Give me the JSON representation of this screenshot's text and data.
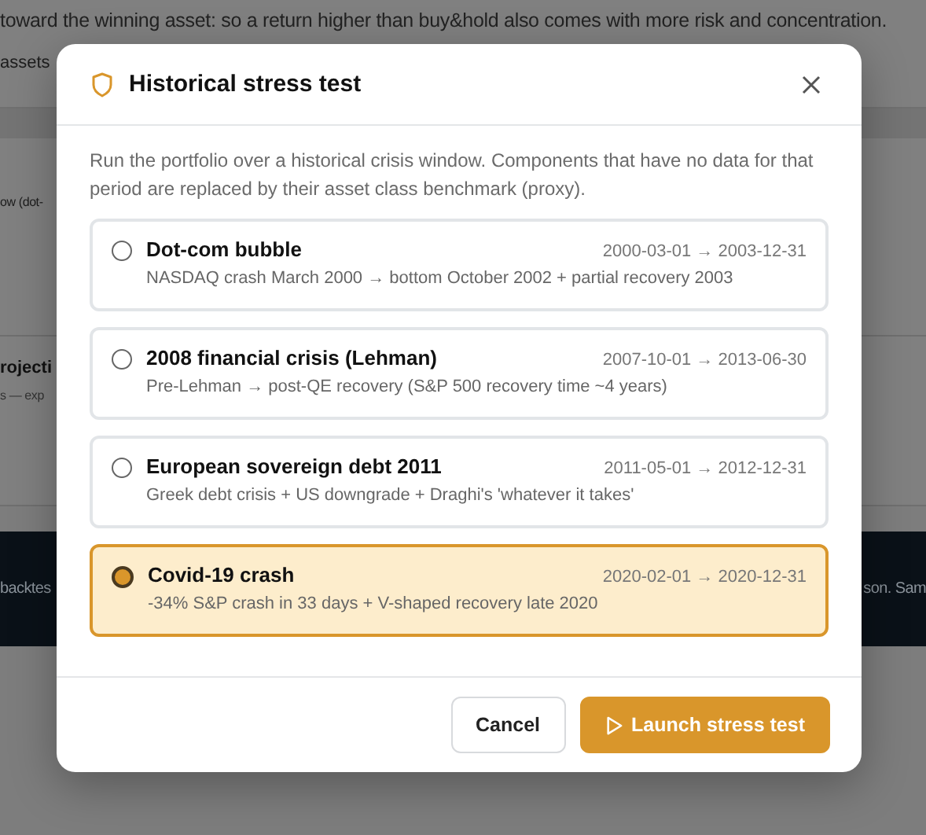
{
  "background": {
    "intro_text": "toward the winning asset: so a return higher than buy&hold also comes with more risk and concentration.",
    "assets_text": "assets",
    "dotcom_text": "ow (dot-",
    "projection_title": "rojecti",
    "projection_text": "s — exp",
    "banner_left": "backtes",
    "banner_right": "son. Sam"
  },
  "dialog": {
    "title": "Historical stress test",
    "description": "Run the portfolio over a historical crisis window. Components that have no data for that period are replaced by their asset class benchmark (proxy).",
    "options": [
      {
        "title": "Dot-com bubble",
        "dates": "2000-03-01 → 2003-12-31",
        "description": "NASDAQ crash March 2000 → bottom October 2002 + partial recovery 2003",
        "selected": false
      },
      {
        "title": "2008 financial crisis (Lehman)",
        "dates": "2007-10-01 → 2013-06-30",
        "description": "Pre-Lehman → post-QE recovery (S&P 500 recovery time ~4 years)",
        "selected": false
      },
      {
        "title": "European sovereign debt 2011",
        "dates": "2011-05-01 → 2012-12-31",
        "description": "Greek debt crisis + US downgrade + Draghi's 'whatever it takes'",
        "selected": false
      },
      {
        "title": "Covid-19 crash",
        "dates": "2020-02-01 → 2020-12-31",
        "description": "-34% S&P crash in 33 days + V-shaped recovery late 2020",
        "selected": true
      }
    ],
    "buttons": [
      {
        "label": "Cancel",
        "kind": "secondary"
      },
      {
        "label": "Launch stress test",
        "kind": "primary"
      }
    ]
  }
}
